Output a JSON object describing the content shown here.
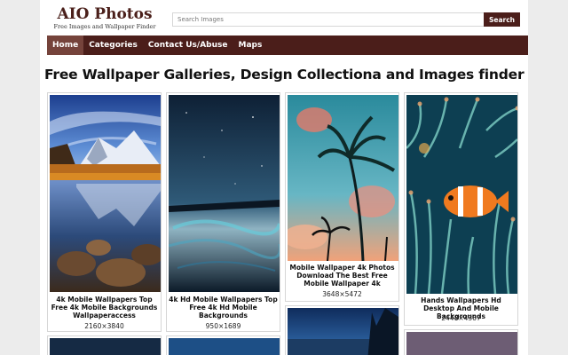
{
  "header": {
    "logo_title": "AIO Photos",
    "logo_tagline": "Free Images and Wallpaper Finder",
    "search_placeholder": "Search Images",
    "search_button": "Search"
  },
  "nav": {
    "items": [
      {
        "label": "Home",
        "active": true
      },
      {
        "label": "Categories"
      },
      {
        "label": "Contact Us/Abuse"
      },
      {
        "label": "Maps"
      }
    ]
  },
  "page_title": "Free Wallpaper Galleries, Design Collectiona and Images finder",
  "gallery": [
    {
      "caption": "4k Mobile Wallpapers Top Free 4k Mobile Backgrounds Wallpaperaccess",
      "dimensions": "2160×3840"
    },
    {
      "caption": "4k Hd Mobile Wallpapers Top Free 4k Hd Mobile Backgrounds",
      "dimensions": "950×1689"
    },
    {
      "caption": "Mobile Wallpaper 4k Photos Download The Best Free Mobile Wallpaper 4k",
      "dimensions": "3648×5472"
    },
    {
      "caption": "Hands Wallpapers Hd Desktop And Mobile Backgrounds",
      "dimensions": "2448×4367"
    }
  ],
  "colors": {
    "brand": "#4b1e1a",
    "nav_active": "#75433b"
  }
}
